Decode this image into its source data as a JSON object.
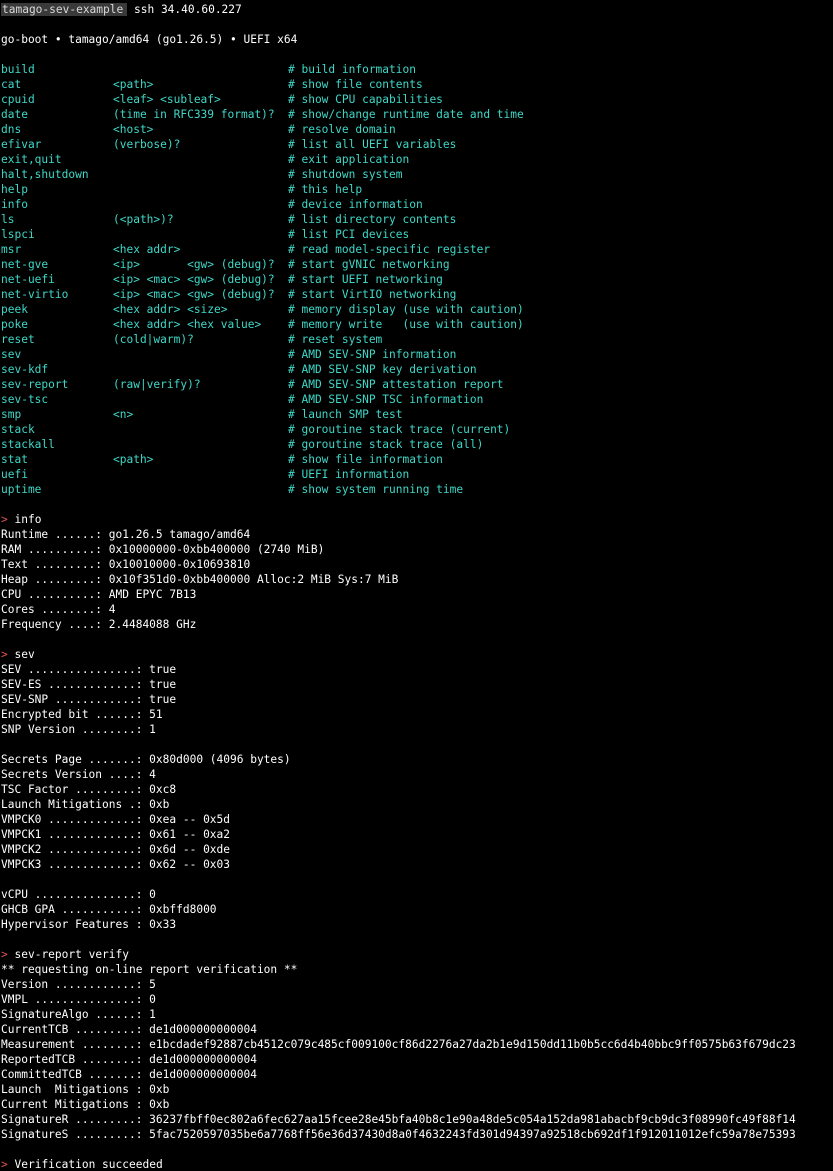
{
  "titlebar": {
    "session": "tamago-sev-example",
    "command": "ssh 34.40.60.227"
  },
  "banner": "go-boot • tamago/amd64 (go1.26.5) • UEFI x64",
  "colors": {
    "background": "#000000",
    "text": "#ffffff",
    "help_text": "#3fd7c7",
    "prompt": "#e05050",
    "badge_bg": "#3a3a3a"
  },
  "help": [
    {
      "cmd": "build",
      "args": "",
      "desc": "# build information"
    },
    {
      "cmd": "cat",
      "args": "<path>",
      "desc": "# show file contents"
    },
    {
      "cmd": "cpuid",
      "args": "<leaf> <subleaf>",
      "desc": "# show CPU capabilities"
    },
    {
      "cmd": "date",
      "args": "(time in RFC339 format)?",
      "desc": "# show/change runtime date and time"
    },
    {
      "cmd": "dns",
      "args": "<host>",
      "desc": "# resolve domain"
    },
    {
      "cmd": "efivar",
      "args": "(verbose)?",
      "desc": "# list all UEFI variables"
    },
    {
      "cmd": "exit,quit",
      "args": "",
      "desc": "# exit application"
    },
    {
      "cmd": "halt,shutdown",
      "args": "",
      "desc": "# shutdown system"
    },
    {
      "cmd": "help",
      "args": "",
      "desc": "# this help"
    },
    {
      "cmd": "info",
      "args": "",
      "desc": "# device information"
    },
    {
      "cmd": "ls",
      "args": "(<path>)?",
      "desc": "# list directory contents"
    },
    {
      "cmd": "lspci",
      "args": "",
      "desc": "# list PCI devices"
    },
    {
      "cmd": "msr",
      "args": "<hex addr>",
      "desc": "# read model-specific register"
    },
    {
      "cmd": "net-gve",
      "args": "<ip>       <gw> (debug)?",
      "desc": "# start gVNIC networking"
    },
    {
      "cmd": "net-uefi",
      "args": "<ip> <mac> <gw> (debug)?",
      "desc": "# start UEFI networking"
    },
    {
      "cmd": "net-virtio",
      "args": "<ip> <mac> <gw> (debug)?",
      "desc": "# start VirtIO networking"
    },
    {
      "cmd": "peek",
      "args": "<hex addr> <size>",
      "desc": "# memory display (use with caution)"
    },
    {
      "cmd": "poke",
      "args": "<hex addr> <hex value>",
      "desc": "# memory write   (use with caution)"
    },
    {
      "cmd": "reset",
      "args": "(cold|warm)?",
      "desc": "# reset system"
    },
    {
      "cmd": "sev",
      "args": "",
      "desc": "# AMD SEV-SNP information"
    },
    {
      "cmd": "sev-kdf",
      "args": "",
      "desc": "# AMD SEV-SNP key derivation"
    },
    {
      "cmd": "sev-report",
      "args": "(raw|verify)?",
      "desc": "# AMD SEV-SNP attestation report"
    },
    {
      "cmd": "sev-tsc",
      "args": "",
      "desc": "# AMD SEV-SNP TSC information"
    },
    {
      "cmd": "smp",
      "args": "<n>",
      "desc": "# launch SMP test"
    },
    {
      "cmd": "stack",
      "args": "",
      "desc": "# goroutine stack trace (current)"
    },
    {
      "cmd": "stackall",
      "args": "",
      "desc": "# goroutine stack trace (all)"
    },
    {
      "cmd": "stat",
      "args": "<path>",
      "desc": "# show file information"
    },
    {
      "cmd": "uefi",
      "args": "",
      "desc": "# UEFI information"
    },
    {
      "cmd": "uptime",
      "args": "",
      "desc": "# show system running time"
    }
  ],
  "prompt_symbol": ">",
  "info": {
    "command": "info",
    "lines": [
      "Runtime ......: go1.26.5 tamago/amd64",
      "RAM ..........: 0x10000000-0xbb400000 (2740 MiB)",
      "Text .........: 0x10010000-0x10693810",
      "Heap .........: 0x10f351d0-0xbb400000 Alloc:2 MiB Sys:7 MiB",
      "CPU ..........: AMD EPYC 7B13",
      "Cores ........: 4",
      "Frequency ....: 2.4484088 GHz"
    ]
  },
  "sev": {
    "command": "sev",
    "group1": [
      "SEV ................: true",
      "SEV-ES .............: true",
      "SEV-SNP ............: true",
      "Encrypted bit ......: 51",
      "SNP Version ........: 1"
    ],
    "group2": [
      "Secrets Page .......: 0x80d000 (4096 bytes)",
      "Secrets Version ....: 4",
      "TSC Factor .........: 0xc8",
      "Launch Mitigations .: 0xb",
      "VMPCK0 .............: 0xea -- 0x5d",
      "VMPCK1 .............: 0x61 -- 0xa2",
      "VMPCK2 .............: 0x6d -- 0xde",
      "VMPCK3 .............: 0x62 -- 0x03"
    ],
    "group3": [
      "vCPU ...............: 0",
      "GHCB GPA ...........: 0xbffd8000",
      "Hypervisor Features : 0x33"
    ]
  },
  "report": {
    "command": "sev-report verify",
    "lines": [
      "** requesting on-line report verification **",
      "Version ............: 5",
      "VMPL ...............: 0",
      "SignatureAlgo ......: 1",
      "CurrentTCB .........: de1d000000000004",
      "Measurement ........: e1bcdadef92887cb4512c079c485cf009100cf86d2276a27da2b1e9d150dd11b0b5cc6d4b40bbc9ff0575b63f679dc23",
      "ReportedTCB ........: de1d000000000004",
      "CommittedTCB .......: de1d000000000004",
      "Launch  Mitigations : 0xb",
      "Current Mitigations : 0xb",
      "SignatureR .........: 36237fbff0ec802a6fec627aa15fcee28e45bfa40b8c1e90a48de5c054a152da981abacbf9cb9dc3f08990fc49f88f14",
      "SignatureS .........: 5fac7520597035be6a7768ff56e36d37430d8a0f4632243fd301d94397a92518cb692df1f912011012efc59a78e75393"
    ],
    "result": "Verification succeeded"
  }
}
